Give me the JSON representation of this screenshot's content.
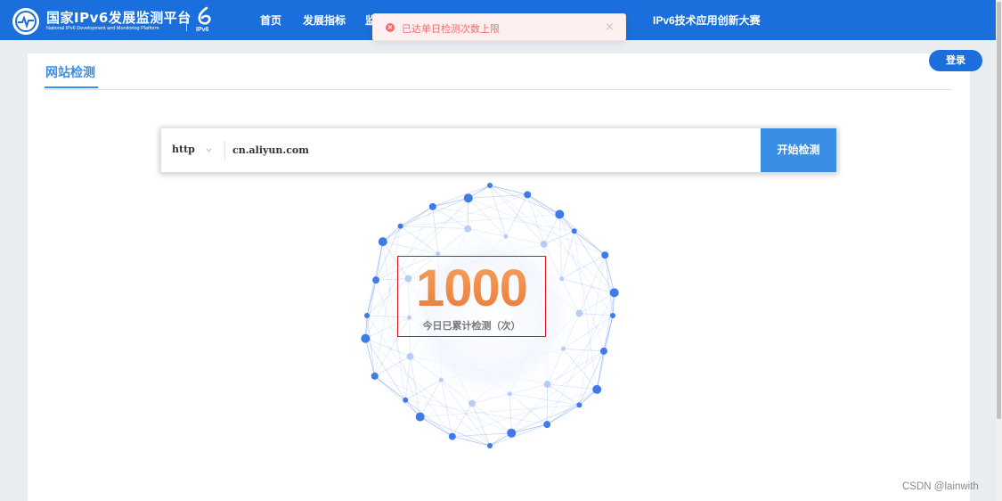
{
  "brand": {
    "title": "国家IPv6发展监测平台",
    "subtitle": "National IPv6 Development and Monitoring Platform",
    "mark_label": "IPv6"
  },
  "nav": {
    "items": [
      "首页",
      "发展指标",
      "监",
      "IPv6技术应用创新大赛"
    ]
  },
  "toast": {
    "message": "已达单日检测次数上限",
    "close": "×",
    "type": "error"
  },
  "header": {
    "login_label": "登录"
  },
  "page": {
    "title": "网站检测"
  },
  "search": {
    "protocol": "http",
    "url_value": "cn.aliyun.com",
    "button_label": "开始检测"
  },
  "stats": {
    "count": "1000",
    "label": "今日已累计检测（次）"
  },
  "watermark": "CSDN @lainwith",
  "colors": {
    "brand_blue": "#1a6fdc",
    "accent_blue": "#3a8ee6",
    "error_red": "#f56c6c",
    "count_orange": "#f0894a",
    "highlight_border": "#e0131b"
  }
}
